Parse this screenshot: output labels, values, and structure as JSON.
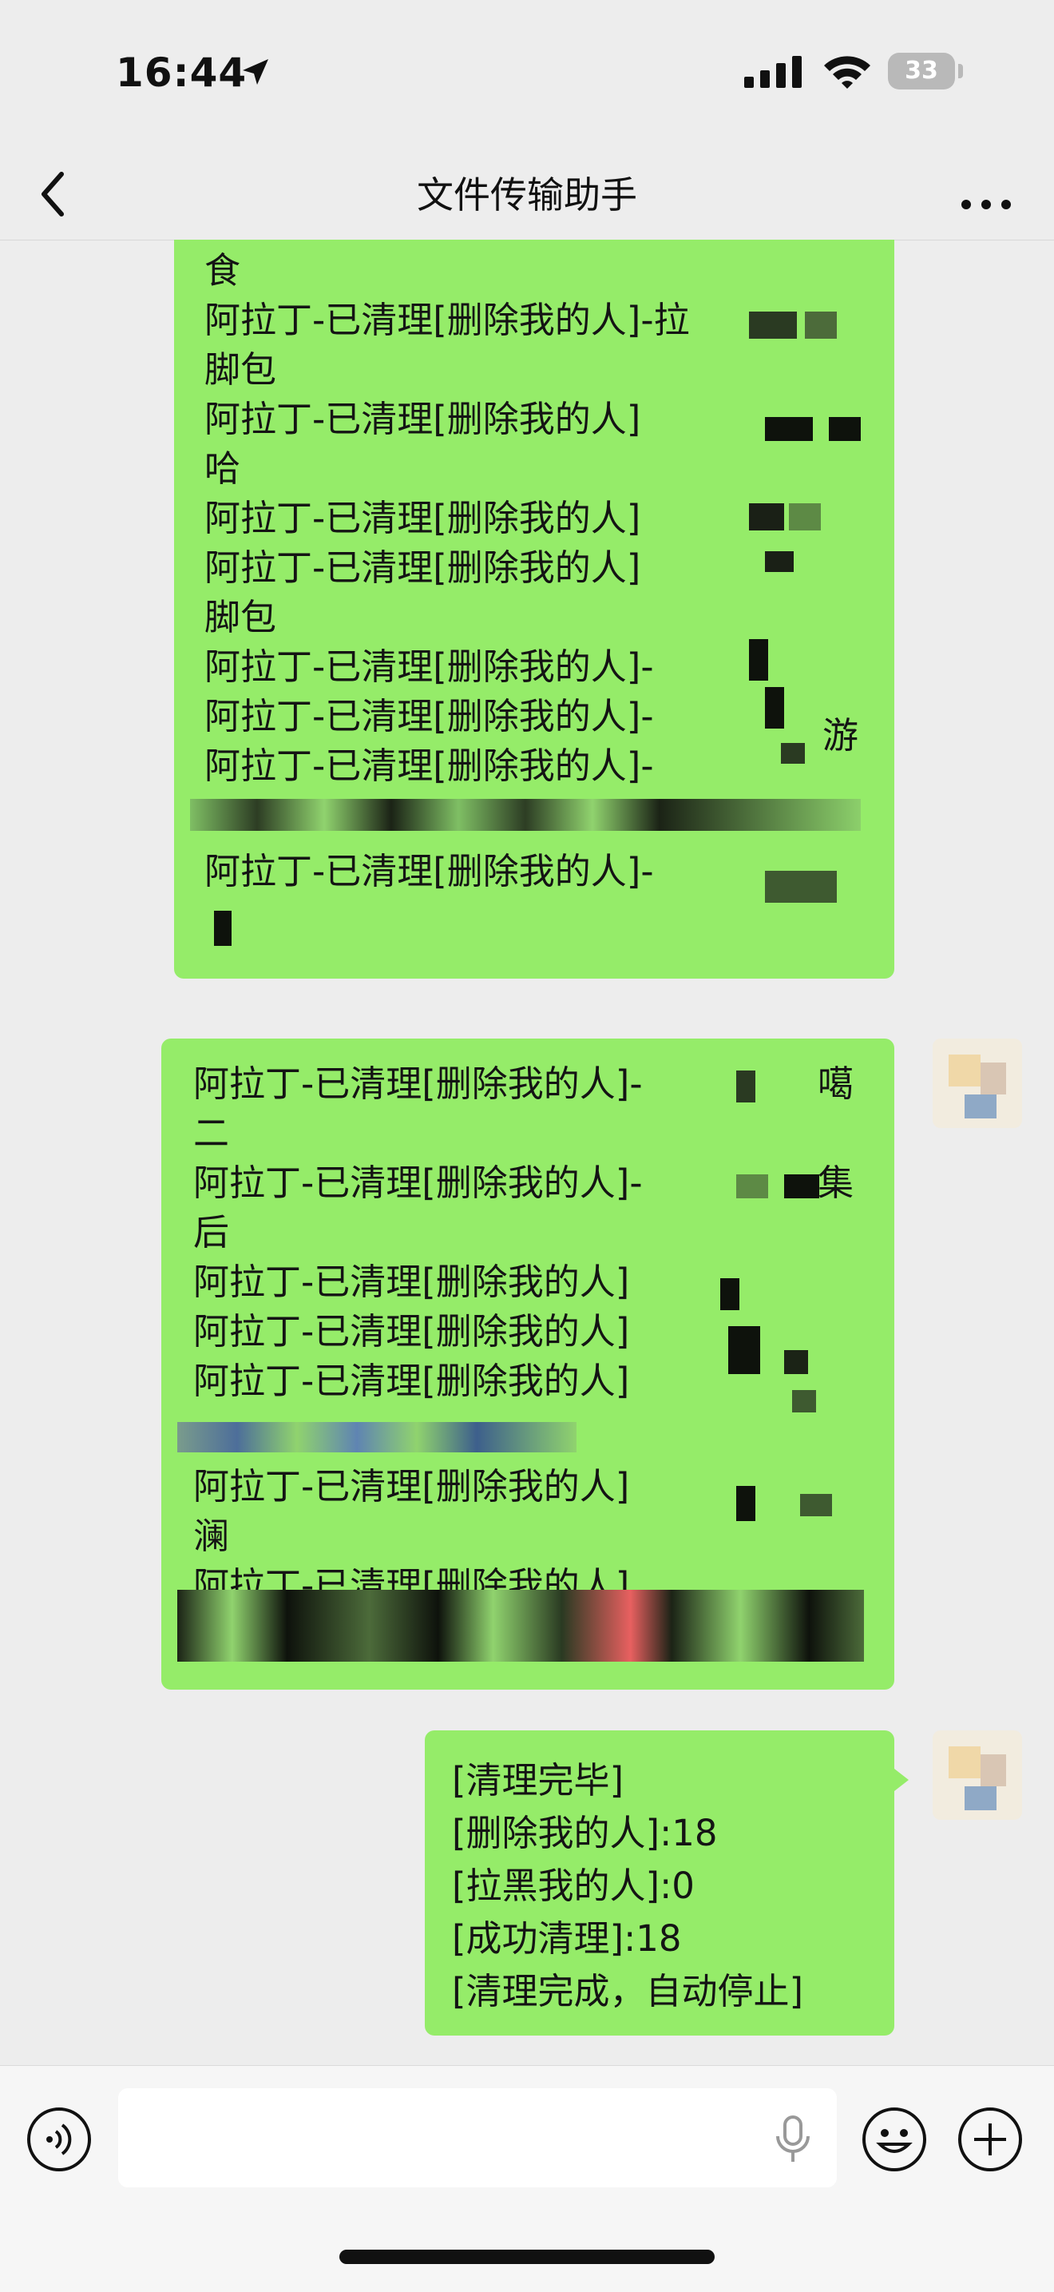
{
  "status_bar": {
    "time": "16:44",
    "battery": "33",
    "icons": [
      "location-arrow-icon",
      "cellular-signal-icon",
      "wifi-icon",
      "battery-icon"
    ]
  },
  "nav": {
    "title": "文件传输助手",
    "back_icon": "chevron-left-icon",
    "more_icon": "more-dots-icon"
  },
  "messages": [
    {
      "lines": [
        "食",
        "阿拉丁-已清理[删除我的人]-拉",
        "脚包",
        "阿拉丁-已清理[删除我的人]",
        "哈",
        "阿拉丁-已清理[删除我的人]",
        "阿拉丁-已清理[删除我的人]",
        "脚包",
        "阿拉丁-已清理[删除我的人]-",
        "阿拉丁-已清理[删除我的人]-",
        "阿拉丁-已清理[删除我的人]-",
        "阿拉丁-已清理[删除我的人]-"
      ],
      "fragments": [
        "游"
      ]
    },
    {
      "lines": [
        "阿拉丁-已清理[删除我的人]-",
        "二",
        "阿拉丁-已清理[删除我的人]-",
        "后",
        "阿拉丁-已清理[删除我的人]",
        "阿拉丁-已清理[删除我的人]",
        "阿拉丁-已清理[删除我的人]",
        "阿拉丁-已清理[删除我的人]",
        "澜",
        "阿拉丁-已清理[删除我的人]"
      ],
      "fragments": [
        "噶",
        "集"
      ]
    },
    {
      "lines": [
        "[清理完毕]",
        "[删除我的人]:18",
        "[拉黑我的人]:0",
        "[成功清理]:18",
        "[清理完成，自动停止]"
      ]
    }
  ],
  "input_bar": {
    "voice_icon": "voice-icon",
    "mic_icon": "microphone-icon",
    "emoji_icon": "emoji-icon",
    "plus_icon": "plus-icon"
  },
  "colors": {
    "bubble": "#95ec69",
    "background": "#ededed",
    "input_bar": "#f6f6f6"
  }
}
